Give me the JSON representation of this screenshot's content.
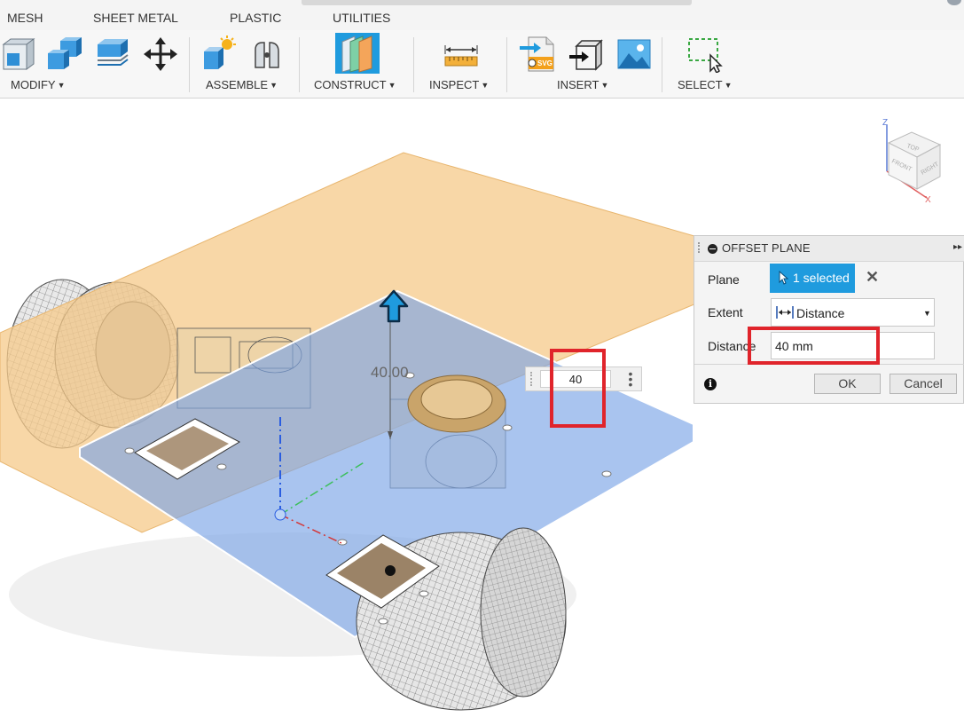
{
  "tabs": [
    {
      "label": "MESH"
    },
    {
      "label": "SHEET METAL"
    },
    {
      "label": "PLASTIC"
    },
    {
      "label": "UTILITIES"
    }
  ],
  "ribbon": {
    "groups": [
      {
        "label": "MODIFY",
        "tools": [
          "press-pull-icon",
          "combine-icon",
          "shell-icon",
          "move-icon"
        ]
      },
      {
        "label": "ASSEMBLE",
        "tools": [
          "new-component-icon",
          "joint-icon"
        ]
      },
      {
        "label": "CONSTRUCT",
        "tools": [
          "offset-plane-icon"
        ]
      },
      {
        "label": "INSPECT",
        "tools": [
          "measure-icon"
        ]
      },
      {
        "label": "INSERT",
        "tools": [
          "insert-svg-icon",
          "insert-mesh-icon",
          "canvas-image-icon"
        ]
      },
      {
        "label": "SELECT",
        "tools": [
          "window-select-icon"
        ]
      }
    ],
    "caret": "▼"
  },
  "viewport": {
    "dimension_label": "40.00",
    "canvas_input_value": "40",
    "viewcube": {
      "top": "TOP",
      "front": "FRONT",
      "right": "RIGHT",
      "z_axis": "Z",
      "x_axis": "X"
    }
  },
  "dialog": {
    "title": "OFFSET PLANE",
    "plane_label": "Plane",
    "plane_value": "1 selected",
    "extent_label": "Extent",
    "extent_value": "Distance",
    "distance_label": "Distance",
    "distance_value": "40 mm",
    "ok_label": "OK",
    "cancel_label": "Cancel",
    "info_symbol": "i",
    "expand_symbol": "▸▸"
  },
  "colors": {
    "accent": "#1f9bde",
    "highlight_box": "#e0242b",
    "sketch_plane": "#f5c98a",
    "offset_plane": "#7ba4e6"
  }
}
